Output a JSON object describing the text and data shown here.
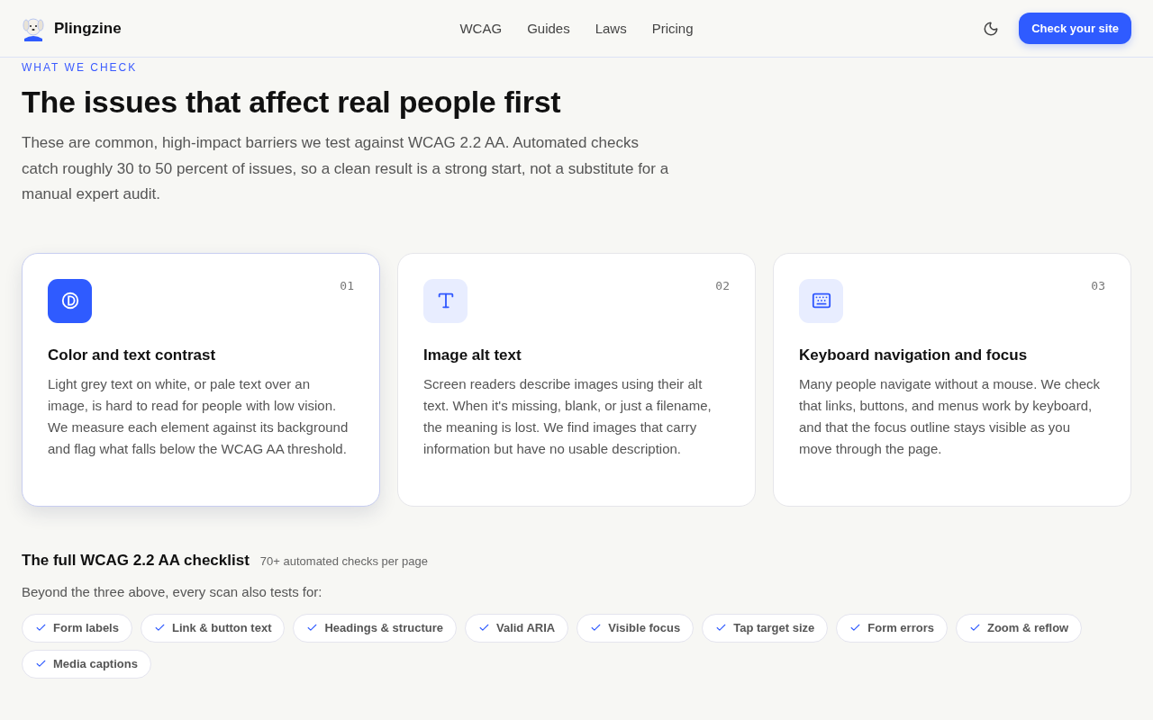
{
  "header": {
    "brand": "Plingzine",
    "nav": [
      {
        "label": "WCAG"
      },
      {
        "label": "Guides"
      },
      {
        "label": "Laws"
      },
      {
        "label": "Pricing"
      }
    ],
    "cta": "Check your site"
  },
  "intro": {
    "eyebrow": "WHAT WE CHECK",
    "title": "The issues that affect real people first",
    "lead": "These are common, high-impact barriers we test against WCAG 2.2 AA. Automated checks catch roughly 30 to 50 percent of issues, so a clean result is a strong start, not a substitute for a manual expert audit."
  },
  "cards": [
    {
      "kind": "contrast",
      "number": "01",
      "title": "Color and text contrast",
      "body": "Light grey text on white, or pale text over an image, is hard to read for people with low vision. We measure each element against its background and flag what falls below the WCAG AA threshold.",
      "selected": true
    },
    {
      "kind": "text",
      "number": "02",
      "title": "Image alt text",
      "body": "Screen readers describe images using their alt text. When it's missing, blank, or just a filename, the meaning is lost. We find images that carry information but have no usable description.",
      "selected": false
    },
    {
      "kind": "keyboard",
      "number": "03",
      "title": "Keyboard navigation and focus",
      "body": "Many people navigate without a mouse. We check that links, buttons, and menus work by keyboard, and that the focus outline stays visible as you move through the page.",
      "selected": false
    }
  ],
  "checklist": {
    "title": "The full WCAG 2.2 AA checklist",
    "note": "70+ automated checks per page",
    "lead": "Beyond the three above, every scan also tests for:",
    "items": [
      "Form labels",
      "Link & button text",
      "Headings & structure",
      "Valid ARIA",
      "Visible focus",
      "Tap target size",
      "Form errors",
      "Zoom & reflow",
      "Media captions"
    ]
  }
}
